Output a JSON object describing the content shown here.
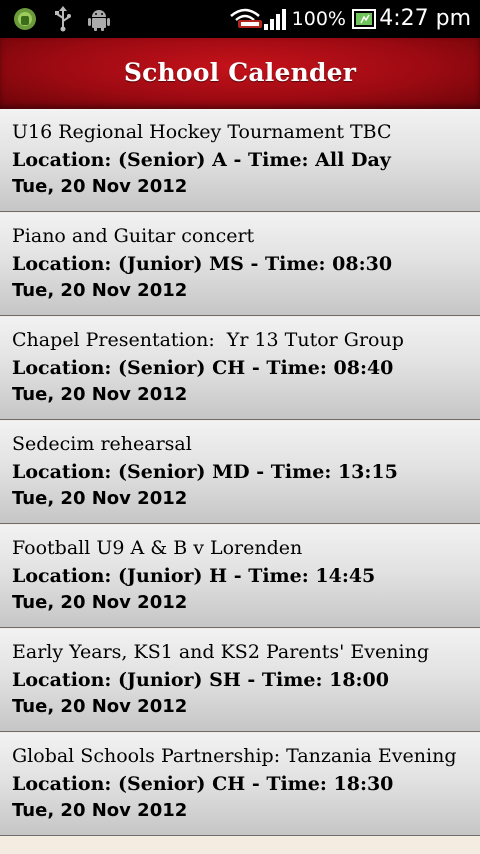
{
  "status_bar": {
    "battery_percent": "100%",
    "time": "4:27 pm",
    "icons": [
      "android-debug-icon",
      "usb-icon",
      "android-icon",
      "wifi-icon",
      "signal-icon",
      "battery-icon"
    ]
  },
  "header": {
    "title": "School Calender"
  },
  "events": [
    {
      "name": "U16 Regional Hockey Tournament TBC",
      "location": "Location: (Senior) A - Time: All Day",
      "date": "Tue, 20 Nov 2012"
    },
    {
      "name": "Piano and Guitar concert",
      "location": "Location: (Junior) MS - Time: 08:30",
      "date": "Tue, 20 Nov 2012"
    },
    {
      "name": "Chapel Presentation:  Yr 13 Tutor Group",
      "location": "Location: (Senior) CH - Time: 08:40",
      "date": "Tue, 20 Nov 2012"
    },
    {
      "name": "Sedecim rehearsal",
      "location": "Location: (Senior) MD - Time: 13:15",
      "date": "Tue, 20 Nov 2012"
    },
    {
      "name": "Football U9 A & B v Lorenden",
      "location": "Location: (Junior) H - Time: 14:45",
      "date": "Tue, 20 Nov 2012"
    },
    {
      "name": "Early Years, KS1 and KS2 Parents' Evening",
      "location": "Location: (Junior) SH - Time: 18:00",
      "date": "Tue, 20 Nov 2012"
    },
    {
      "name": "Global Schools Partnership: Tanzania Evening",
      "location": "Location: (Senior) CH - Time: 18:30",
      "date": "Tue, 20 Nov 2012"
    }
  ]
}
